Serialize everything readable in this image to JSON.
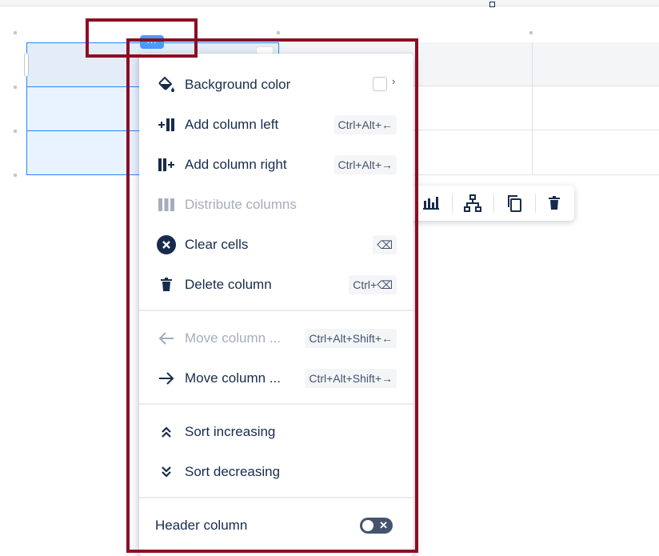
{
  "menu": {
    "background_color": "Background color",
    "add_column_left": "Add column left",
    "add_column_left_shortcut": "Ctrl+Alt+←",
    "add_column_right": "Add column right",
    "add_column_right_shortcut": "Ctrl+Alt+→",
    "distribute_columns": "Distribute columns",
    "clear_cells": "Clear cells",
    "clear_cells_shortcut": "⌫",
    "delete_column": "Delete column",
    "delete_column_shortcut": "Ctrl+⌫",
    "move_column_left": "Move column ...",
    "move_column_left_shortcut": "Ctrl+Alt+Shift+←",
    "move_column_right": "Move column ...",
    "move_column_right_shortcut": "Ctrl+Alt+Shift+→",
    "sort_increasing": "Sort increasing",
    "sort_decreasing": "Sort decreasing",
    "header_column": "Header column",
    "header_column_enabled": false,
    "chevron": "›",
    "toggle_off_glyph": "✕"
  },
  "column_handle_label": "...",
  "icons": {
    "paint_bucket": "paint-bucket-icon",
    "add_left": "add-column-left-icon",
    "add_right": "add-column-right-icon",
    "distribute": "distribute-columns-icon",
    "clear": "clear-cells-icon",
    "delete": "trash-icon",
    "arrow_left": "arrow-left-icon",
    "arrow_right": "arrow-right-icon",
    "sort_up": "double-chevron-up-icon",
    "sort_down": "double-chevron-down-icon"
  },
  "colors": {
    "text": "#172b4d",
    "disabled": "#a5adba",
    "selection": "#2684ff",
    "annotation": "#8b0e23"
  }
}
